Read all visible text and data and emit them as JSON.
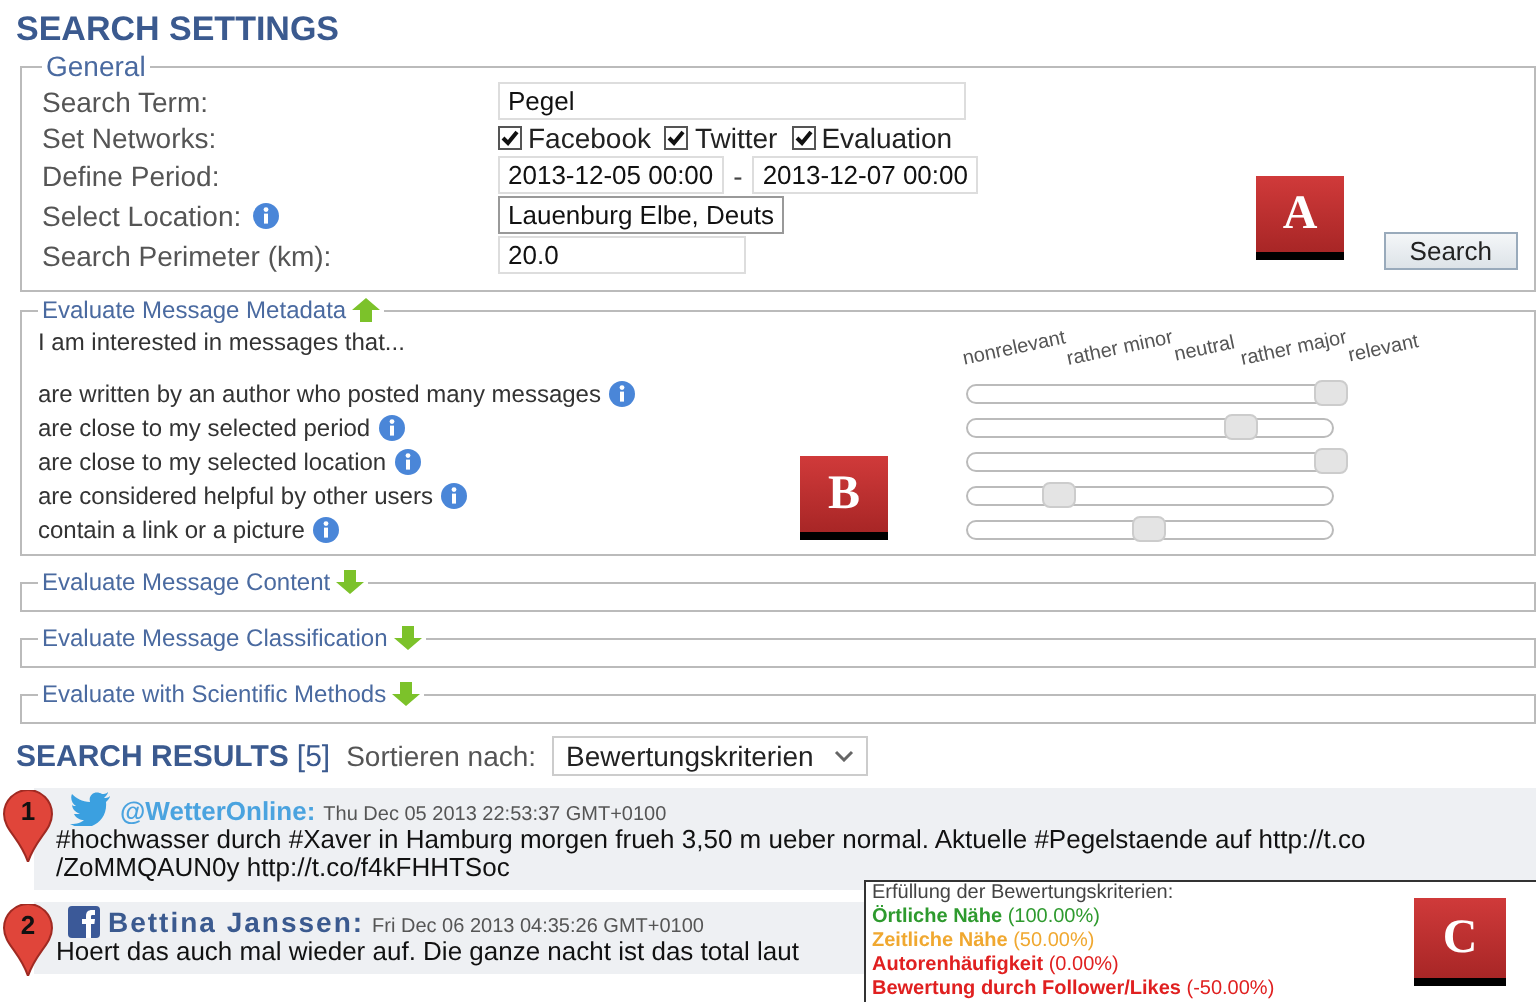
{
  "title": "SEARCH SETTINGS",
  "general": {
    "legend": "General",
    "search_term": {
      "label": "Search Term:",
      "value": "Pegel"
    },
    "networks": {
      "label": "Set Networks:",
      "options": [
        {
          "label": "Facebook",
          "checked": true
        },
        {
          "label": "Twitter",
          "checked": true
        },
        {
          "label": "Evaluation",
          "checked": true
        }
      ]
    },
    "period": {
      "label": "Define Period:",
      "from": "2013-12-05 00:00",
      "separator": "-",
      "to": "2013-12-07 00:00"
    },
    "location": {
      "label": "Select Location:",
      "value": "Lauenburg Elbe, Deuts"
    },
    "perimeter": {
      "label": "Search Perimeter (km):",
      "value": "20.0"
    },
    "search_button": "Search"
  },
  "sections": [
    {
      "legend": "Evaluate Message Metadata",
      "expanded": true,
      "intro": "I am interested in messages that...",
      "scale": [
        "nonrelevant",
        "rather minor",
        "neutral",
        "rather major",
        "relevant"
      ],
      "criteria": [
        {
          "label": "are written by an author who posted many messages",
          "level": 1
        },
        {
          "label": "are close to my selected period",
          "level": 0.75
        },
        {
          "label": "are close to my selected location",
          "level": 1
        },
        {
          "label": "are considered helpful by other users",
          "level": 0.25
        },
        {
          "label": "contain a link or a picture",
          "level": 0.5
        }
      ]
    },
    {
      "legend": "Evaluate Message Content",
      "expanded": false
    },
    {
      "legend": "Evaluate Message Classification",
      "expanded": false
    },
    {
      "legend": "Evaluate with Scientific Methods",
      "expanded": false
    }
  ],
  "results": {
    "title": "SEARCH RESULTS",
    "count": "[5]",
    "sort_label": "Sortieren nach:",
    "sort_value": "Bewertungskriterien",
    "items": [
      {
        "number": "1",
        "kind": "twitter",
        "author": "@WetterOnline:",
        "date": "Thu Dec 05 2013 22:53:37 GMT+0100",
        "lines": [
          "#hochwasser durch #Xaver in Hamburg morgen frueh 3,50 m ueber normal. Aktuelle #Pegelstaende auf http://t.co",
          "/ZoMMQAUN0y http://t.co/f4kFHHTSoc"
        ]
      },
      {
        "number": "2",
        "kind": "facebook",
        "author": "Bettina Janssen:",
        "date": "Fri Dec 06 2013 04:35:26 GMT+0100",
        "lines": [
          "Hoert das auch mal wieder auf. Die ganze nacht ist das total laut"
        ]
      }
    ]
  },
  "tooltip": {
    "title": "Erfüllung der Bewertungskriterien:",
    "rows": [
      {
        "criterion": "Örtliche Nähe",
        "value": "(100.00%)",
        "color": "#2e9a2e"
      },
      {
        "criterion": "Zeitliche Nähe",
        "value": "(50.00%)",
        "color": "#f0a830"
      },
      {
        "criterion": "Autorenhäufigkeit",
        "value": "(0.00%)",
        "color": "#e02020"
      },
      {
        "criterion": "Bewertung durch Follower/Likes",
        "value": "(-50.00%)",
        "color": "#e02020"
      }
    ]
  },
  "annotations": [
    {
      "label": "A"
    },
    {
      "label": "B"
    },
    {
      "label": "C"
    }
  ]
}
